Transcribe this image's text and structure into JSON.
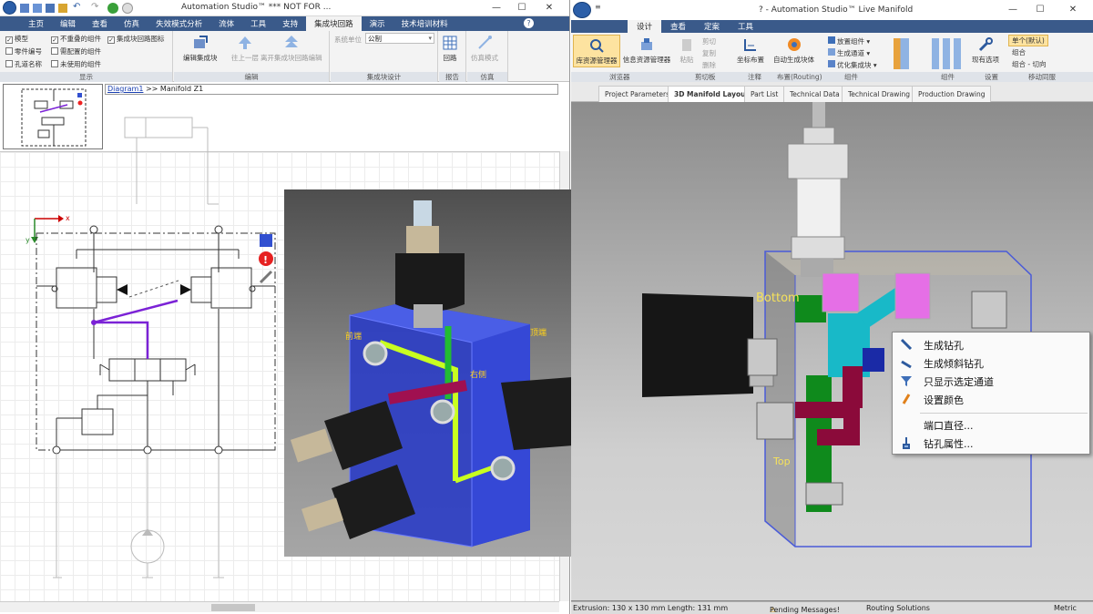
{
  "left_window": {
    "title": "Automation Studio™  *** NOT FOR ...",
    "menu": [
      "主页",
      "编辑",
      "查看",
      "仿真",
      "失效模式分析",
      "流体",
      "工具",
      "支持",
      "集成块回路",
      "演示",
      "技术培训材料"
    ],
    "menu_selected_index": 8,
    "ribbon": {
      "checkboxes": [
        {
          "label": "模型",
          "checked": true
        },
        {
          "label": "不重叠的组件",
          "checked": true
        },
        {
          "label": "集成块回路图标",
          "checked": true
        },
        {
          "label": "零件编号",
          "checked": false
        },
        {
          "label": "需配置的组件",
          "checked": false
        },
        {
          "label": "孔道名称",
          "checked": false
        },
        {
          "label": "未使用的组件",
          "checked": false
        }
      ],
      "show_group": "显示",
      "edit_buttons": [
        "编辑集成块",
        "往上一层",
        "离开集成块回路编辑"
      ],
      "edit_group": "编辑",
      "unit_label": "系统单位",
      "unit_value": "公制",
      "block_group": "集成块设计",
      "report_button": "回路",
      "report_group": "报告",
      "sim_button": "仿真模式",
      "sim_group": "仿真"
    },
    "breadcrumb": {
      "link": "Diagram1",
      "rest": " >> Manifold Z1"
    }
  },
  "right_window": {
    "title": "? - Automation Studio™ Live Manifold",
    "menu": [
      "设计",
      "查看",
      "定案",
      "工具"
    ],
    "menu_selected_index": 0,
    "ribbon_buttons": [
      "库资源管理器",
      "信息资源管理器",
      "粘贴",
      "剪切",
      "复制",
      "删除",
      "坐标布置",
      "自动生成块体",
      "放置组件",
      "生成通道",
      "优化集成块",
      "现有选项",
      "单个(默认)",
      "组合",
      "组合 - 切向"
    ],
    "ribbon_groups": [
      "浏览器",
      "剪切板",
      "注释",
      "布置(Routing)",
      "组件",
      "组件",
      "设置",
      "移动同服"
    ],
    "tabs": [
      "Project Parameters",
      "3D Manifold Layout",
      "Part List",
      "Technical Data",
      "Technical Drawing",
      "Production Drawing"
    ],
    "tab_selected_index": 1,
    "viewport_labels": {
      "bottom": "Bottom",
      "top": "Top"
    },
    "context_menu": [
      "生成钻孔",
      "生成倾斜钻孔",
      "只显示选定通道",
      "设置颜色",
      "端口直径...",
      "钻孔属性..."
    ],
    "status": {
      "extrusion": "Extrusion: 130 x 130  mm  Length: 131  mm",
      "pending": "Pending Messages!",
      "routing": "Routing Solutions",
      "units": "Metric"
    }
  },
  "inset_labels": {
    "front": "前端",
    "right": "右侧",
    "top": "顶端"
  },
  "colors": {
    "menu_bg": "#3a5a8a",
    "ribbon_bg": "#f3f3f3",
    "selected_tab": "#fde3a0",
    "block_blue": "#2c3ec4",
    "purple_line": "#7b22d6"
  }
}
